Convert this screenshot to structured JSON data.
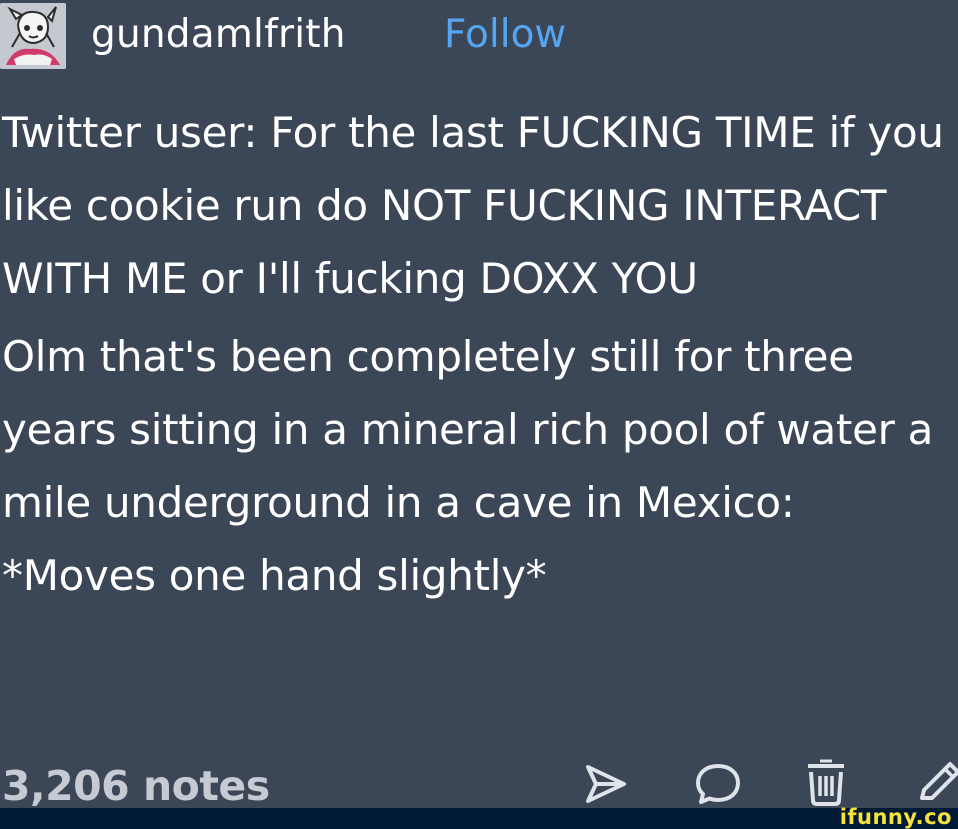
{
  "header": {
    "avatar_icon": "anime-character-avatar-icon",
    "username": "gundamlfrith",
    "follow_label": "Follow"
  },
  "post": {
    "paragraphs": [
      "Twitter user: For the last FUCKING TIME if you like cookie run do NOT FUCKING INTERACT WITH ME or I'll fucking DOXX YOU",
      "Olm that's been completely still for three years sitting in a mineral rich pool of water a mile underground in a cave in Mexico: *Moves one hand slightly*"
    ]
  },
  "footer": {
    "notes": "3,206 notes",
    "icons": [
      "share-icon",
      "reply-icon",
      "reblog-icon",
      "edit-icon"
    ]
  },
  "watermark": {
    "text": "ifunny.co"
  },
  "colors": {
    "post_background": "#3b4657",
    "text": "#ffffff",
    "follow_link": "#55a5f0",
    "notes_text": "#c5cad3",
    "watermark_bar": "#001935",
    "watermark_text": "#f7e23a"
  }
}
